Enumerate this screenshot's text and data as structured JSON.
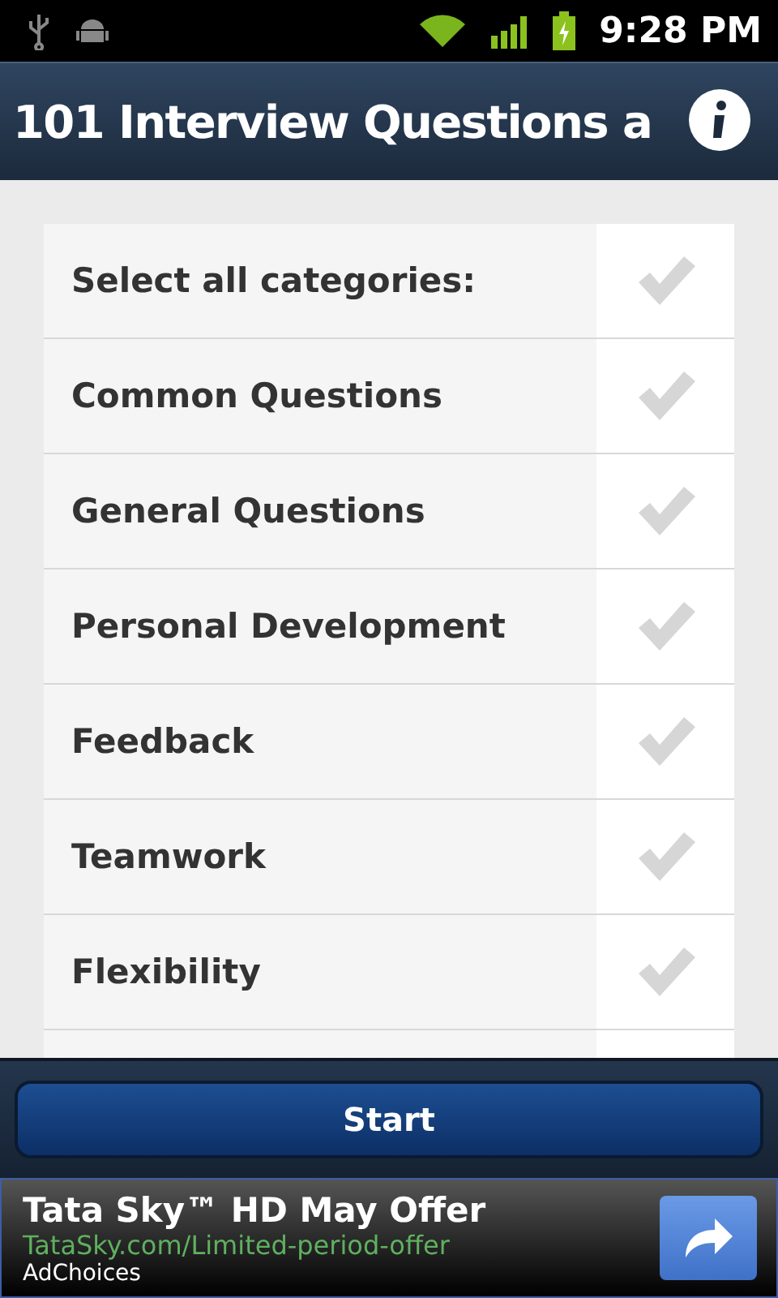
{
  "status_bar": {
    "time": "9:28 PM"
  },
  "title_bar": {
    "title": "101 Interview Questions a"
  },
  "categories": [
    {
      "label": "Select all categories:",
      "checked": false
    },
    {
      "label": "Common Questions",
      "checked": false
    },
    {
      "label": "General Questions",
      "checked": false
    },
    {
      "label": "Personal Development",
      "checked": false
    },
    {
      "label": "Feedback",
      "checked": false
    },
    {
      "label": "Teamwork",
      "checked": false
    },
    {
      "label": "Flexibility",
      "checked": false
    }
  ],
  "start_button": {
    "label": "Start"
  },
  "ad": {
    "headline": "Tata Sky™ HD May Offer",
    "url": "TataSky.com/Limited-period-offer",
    "ad_choices": "AdChoices"
  }
}
